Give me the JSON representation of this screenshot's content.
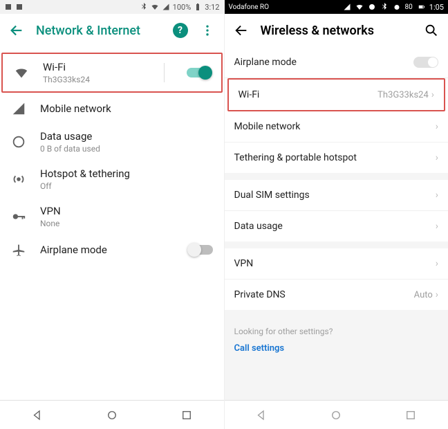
{
  "left": {
    "status": {
      "battery": "100%",
      "time": "3:12"
    },
    "appbar": {
      "title": "Network & Internet",
      "help": "?"
    },
    "items": {
      "wifi": {
        "title": "Wi-Fi",
        "subtitle": "Th3G33ks24"
      },
      "mobile": {
        "title": "Mobile network"
      },
      "data": {
        "title": "Data usage",
        "subtitle": "0 B of data used"
      },
      "hotspot": {
        "title": "Hotspot & tethering",
        "subtitle": "Off"
      },
      "vpn": {
        "title": "VPN",
        "subtitle": "None"
      },
      "airplane": {
        "title": "Airplane mode"
      }
    }
  },
  "right": {
    "status": {
      "carrier": "Vodafone RO",
      "time": "1:05"
    },
    "appbar": {
      "title": "Wireless & networks"
    },
    "items": {
      "airplane": {
        "label": "Airplane mode"
      },
      "wifi": {
        "label": "Wi-Fi",
        "value": "Th3G33ks24"
      },
      "mobile": {
        "label": "Mobile network"
      },
      "tether": {
        "label": "Tethering & portable hotspot"
      },
      "dualsim": {
        "label": "Dual SIM settings"
      },
      "datausage": {
        "label": "Data usage"
      },
      "vpn": {
        "label": "VPN"
      },
      "pdns": {
        "label": "Private DNS",
        "value": "Auto"
      }
    },
    "footer": {
      "question": "Looking for other settings?",
      "link": "Call settings"
    }
  }
}
